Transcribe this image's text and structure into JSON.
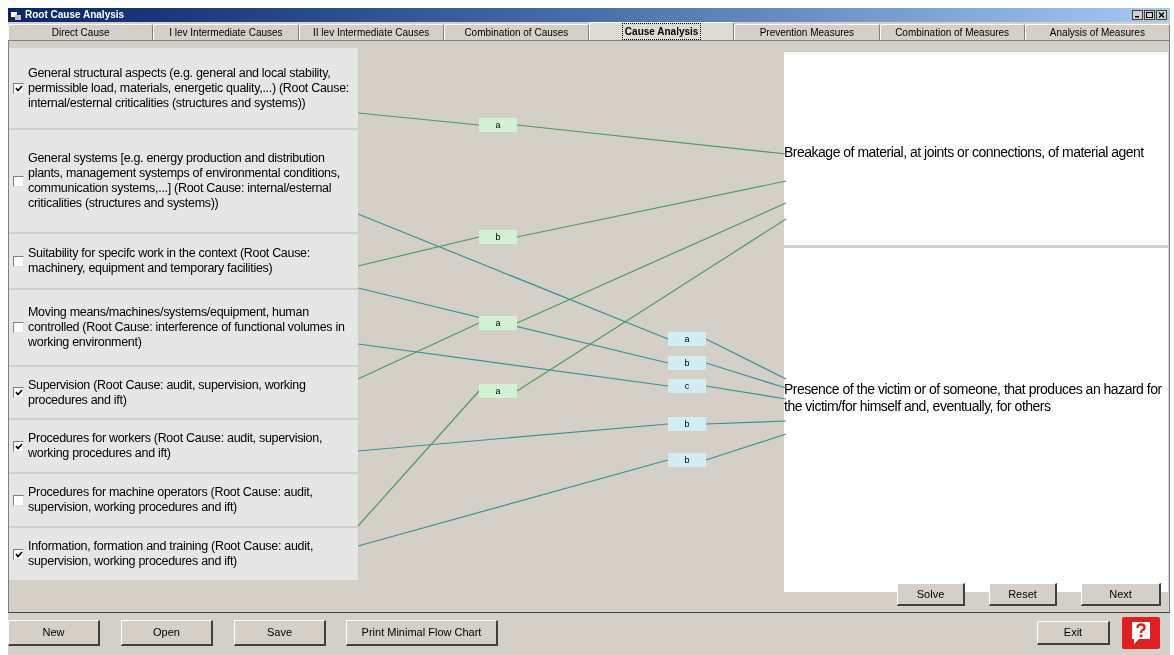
{
  "window": {
    "title": "Root Cause Analysis"
  },
  "tabs": [
    {
      "label": "Direct Cause",
      "selected": false
    },
    {
      "label": "I lev Intermediate Causes",
      "selected": false
    },
    {
      "label": "II lev Intermediate Causes",
      "selected": false
    },
    {
      "label": "Combination of Causes",
      "selected": false
    },
    {
      "label": "Cause Analysis",
      "selected": true
    },
    {
      "label": "Prevention Measures",
      "selected": false
    },
    {
      "label": "Combination of Measures",
      "selected": false
    },
    {
      "label": "Analysis of Measures",
      "selected": false
    }
  ],
  "causes": [
    {
      "text": "General structural aspects (e.g. general and local stability, permissible load, materials, energetic quality,...) (Root Cause: internal/esternal criticalities (structures and systems))",
      "checked": true,
      "links": [
        {
          "label": "a",
          "kind": "breakage"
        }
      ]
    },
    {
      "text": "General systems [e.g. energy production and distribution plants, management systemps of environmental conditions, communication systems,...] (Root Cause: internal/esternal criticalities (structures and systems))",
      "checked": false,
      "links": [
        {
          "label": "a",
          "kind": "presence"
        }
      ]
    },
    {
      "text": "Suitability for specifc work in the context (Root Cause: machinery, equipment and temporary facilities)",
      "checked": false,
      "links": [
        {
          "label": "b",
          "kind": "breakage"
        },
        {
          "label": "b",
          "kind": "presence"
        }
      ]
    },
    {
      "text": "Moving means/machines/systems/equipment, human controlled (Root Cause: interference of functional volumes in working environment)",
      "checked": false,
      "links": [
        {
          "label": "c",
          "kind": "presence"
        }
      ]
    },
    {
      "text": "Supervision (Root Cause: audit, supervision, working procedures and ift)",
      "checked": true,
      "links": [
        {
          "label": "a",
          "kind": "breakage"
        }
      ]
    },
    {
      "text": "Procedures for workers (Root Cause: audit, supervision, working procedures and ift)",
      "checked": true,
      "links": [
        {
          "label": "b",
          "kind": "presence"
        }
      ]
    },
    {
      "text": "Procedures for machine operators (Root Cause: audit, supervision, working procedures and ift)",
      "checked": false,
      "links": [
        {
          "label": "a",
          "kind": "breakage"
        }
      ]
    },
    {
      "text": "Information, formation and training (Root Cause: audit, supervision, working procedures and ift)",
      "checked": true,
      "links": [
        {
          "label": "b",
          "kind": "presence"
        }
      ]
    }
  ],
  "effects": [
    {
      "text": "Breakage of material, at joints or connections, of material agent"
    },
    {
      "text": "Presence of the victim or of someone, that produces an hazard for the victim/for himself and, eventually, for others"
    }
  ],
  "panel_buttons": [
    "Solve",
    "Reset",
    "Next"
  ],
  "bottom_buttons": [
    "New",
    "Open",
    "Save",
    "Print Minimal Flow Chart"
  ],
  "exit_button": "Exit"
}
